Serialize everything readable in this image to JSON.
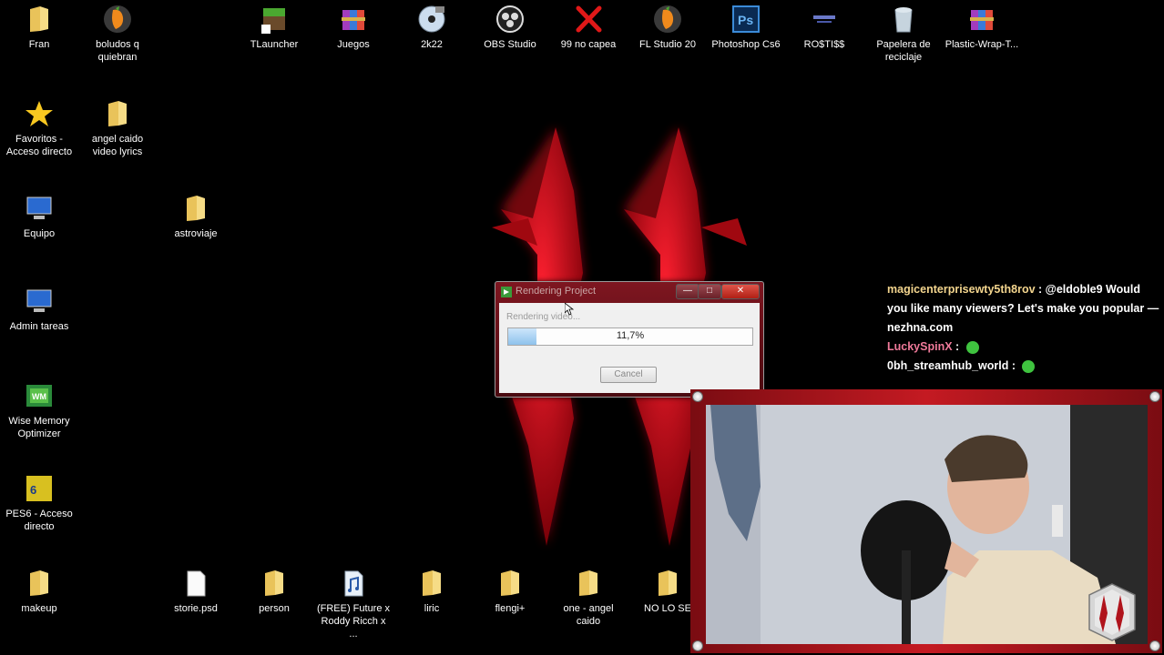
{
  "desktop": {
    "icons": [
      {
        "id": "fran",
        "label": "Fran",
        "type": "folder"
      },
      {
        "id": "boludos",
        "label": "boludos q quiebran",
        "type": "flstudio"
      },
      {
        "id": "tlauncher",
        "label": "TLauncher",
        "type": "tlauncher"
      },
      {
        "id": "juegos",
        "label": "Juegos",
        "type": "winrar"
      },
      {
        "id": "2k22",
        "label": "2k22",
        "type": "disc"
      },
      {
        "id": "obs",
        "label": "OBS Studio",
        "type": "obs"
      },
      {
        "id": "99nocapea",
        "label": "99 no capea",
        "type": "redx"
      },
      {
        "id": "flstudio",
        "label": "FL Studio 20",
        "type": "flstudio"
      },
      {
        "id": "photoshop",
        "label": "Photoshop Cs6",
        "type": "ps"
      },
      {
        "id": "rostiss",
        "label": "RO$TI$$",
        "type": "bar"
      },
      {
        "id": "papelera",
        "label": "Papelera de reciclaje",
        "type": "trash"
      },
      {
        "id": "plasticwrap",
        "label": "Plastic-Wrap-T...",
        "type": "winrar"
      },
      {
        "id": "favoritos",
        "label": "Favoritos - Acceso directo",
        "type": "star"
      },
      {
        "id": "angelcaido",
        "label": "angel caido video lyrics",
        "type": "folder"
      },
      {
        "id": "equipo",
        "label": "Equipo",
        "type": "computer"
      },
      {
        "id": "astroviaje",
        "label": "astroviaje",
        "type": "folder"
      },
      {
        "id": "admintareas",
        "label": "Admin tareas",
        "type": "computer"
      },
      {
        "id": "wisememory",
        "label": "Wise Memory Optimizer",
        "type": "wise"
      },
      {
        "id": "pes6",
        "label": "PES6 - Acceso directo",
        "type": "pes"
      },
      {
        "id": "makeup",
        "label": "makeup",
        "type": "folder"
      },
      {
        "id": "storie",
        "label": "storie.psd",
        "type": "file"
      },
      {
        "id": "person",
        "label": "person",
        "type": "folder"
      },
      {
        "id": "freefuture",
        "label": "(FREE) Future x Roddy Ricch x ...",
        "type": "audio"
      },
      {
        "id": "liric",
        "label": "liric",
        "type": "folder"
      },
      {
        "id": "flengi",
        "label": "flengi+",
        "type": "folder"
      },
      {
        "id": "oneangel",
        "label": "one - angel caido",
        "type": "folder"
      },
      {
        "id": "nolose",
        "label": "NO LO SE",
        "type": "folder"
      }
    ]
  },
  "dialog": {
    "title": "Rendering Project",
    "status": "Rendering video...",
    "progress_text": "11,7%",
    "progress_value": 0.117,
    "cancel_label": "Cancel",
    "min_label": "—",
    "max_label": "□",
    "close_label": "✕"
  },
  "chat": {
    "messages": [
      {
        "user": "magicenterprisewty5th8rov",
        "text": " : @eldoble9 Would you like many viewers? Let's make you popular — nezhna.com",
        "color": "gold"
      },
      {
        "user": "LuckySpinX",
        "text": " : ",
        "color": "pink",
        "emote": true
      },
      {
        "user": "0bh_streamhub_world",
        "text": " : ",
        "color": "white",
        "emote": true
      }
    ]
  },
  "colors": {
    "wallpaper_red": "#d0141c",
    "frame_red": "#c41a22",
    "chat_username": "#f3d58e",
    "chat_username_pink": "#f07a9a"
  }
}
